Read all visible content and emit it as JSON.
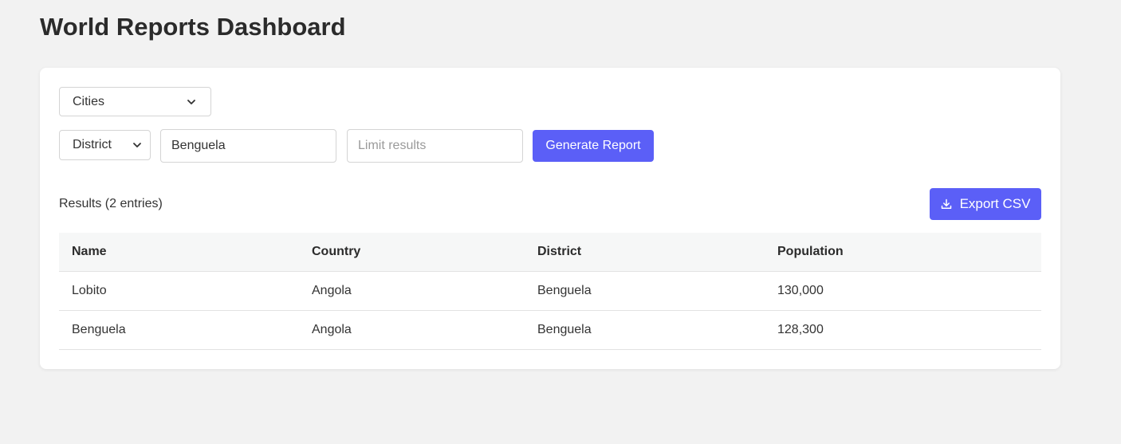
{
  "page": {
    "title": "World Reports Dashboard"
  },
  "controls": {
    "report_type": "Cities",
    "filter_type": "District",
    "filter_value": "Benguela",
    "limit_placeholder": "Limit results",
    "generate_label": "Generate Report"
  },
  "results": {
    "label": "Results (2 entries)",
    "export_label": "Export CSV",
    "export_icon": "download-icon",
    "columns": [
      "Name",
      "Country",
      "District",
      "Population"
    ],
    "rows": [
      [
        "Lobito",
        "Angola",
        "Benguela",
        "130,000"
      ],
      [
        "Benguela",
        "Angola",
        "Benguela",
        "128,300"
      ]
    ]
  },
  "colors": {
    "accent": "#5b5ff7",
    "background": "#f2f2f2",
    "card": "#ffffff"
  }
}
